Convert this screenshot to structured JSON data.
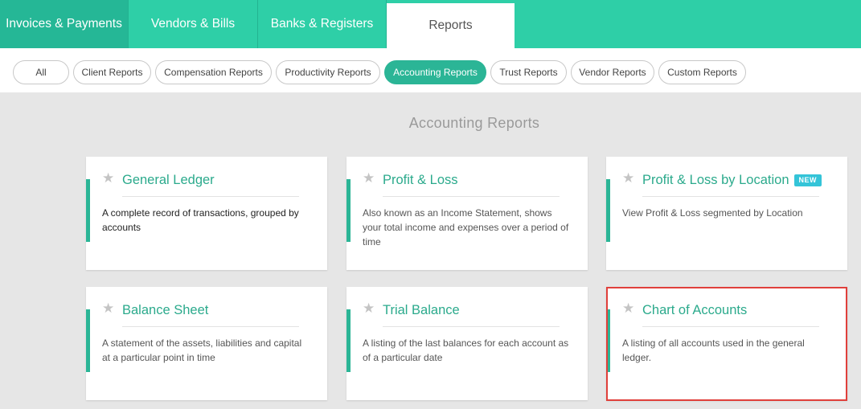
{
  "top_tabs": [
    {
      "label": "Invoices & Payments"
    },
    {
      "label": "Vendors & Bills"
    },
    {
      "label": "Banks & Registers"
    },
    {
      "label": "Reports"
    }
  ],
  "sub_tabs": [
    {
      "label": "All"
    },
    {
      "label": "Client Reports"
    },
    {
      "label": "Compensation Reports"
    },
    {
      "label": "Productivity Reports"
    },
    {
      "label": "Accounting Reports"
    },
    {
      "label": "Trust Reports"
    },
    {
      "label": "Vendor Reports"
    },
    {
      "label": "Custom Reports"
    }
  ],
  "active_sub_tab": "Accounting Reports",
  "section_title": "Accounting Reports",
  "cards": [
    {
      "title": "General Ledger",
      "description": "A complete record of transactions, grouped by accounts"
    },
    {
      "title": "Profit & Loss",
      "description": "Also known as an Income Statement, shows your total income and expenses over a period of time"
    },
    {
      "title": "Profit & Loss by Location",
      "badge": "NEW",
      "description": "View Profit & Loss segmented by Location"
    },
    {
      "title": "Balance Sheet",
      "description": "A statement of the assets, liabilities and capital at a particular point in time"
    },
    {
      "title": "Trial Balance",
      "description": "A listing of the last balances for each account as of a particular date"
    },
    {
      "title": "Chart of Accounts",
      "description": "A listing of all accounts used in the general ledger."
    }
  ],
  "icons": {
    "favorite": "star-icon"
  },
  "colors": {
    "brand": "#2ecfa7",
    "accent": "#2bb596",
    "highlight": "#e0403b",
    "badge": "#34c4d8"
  }
}
